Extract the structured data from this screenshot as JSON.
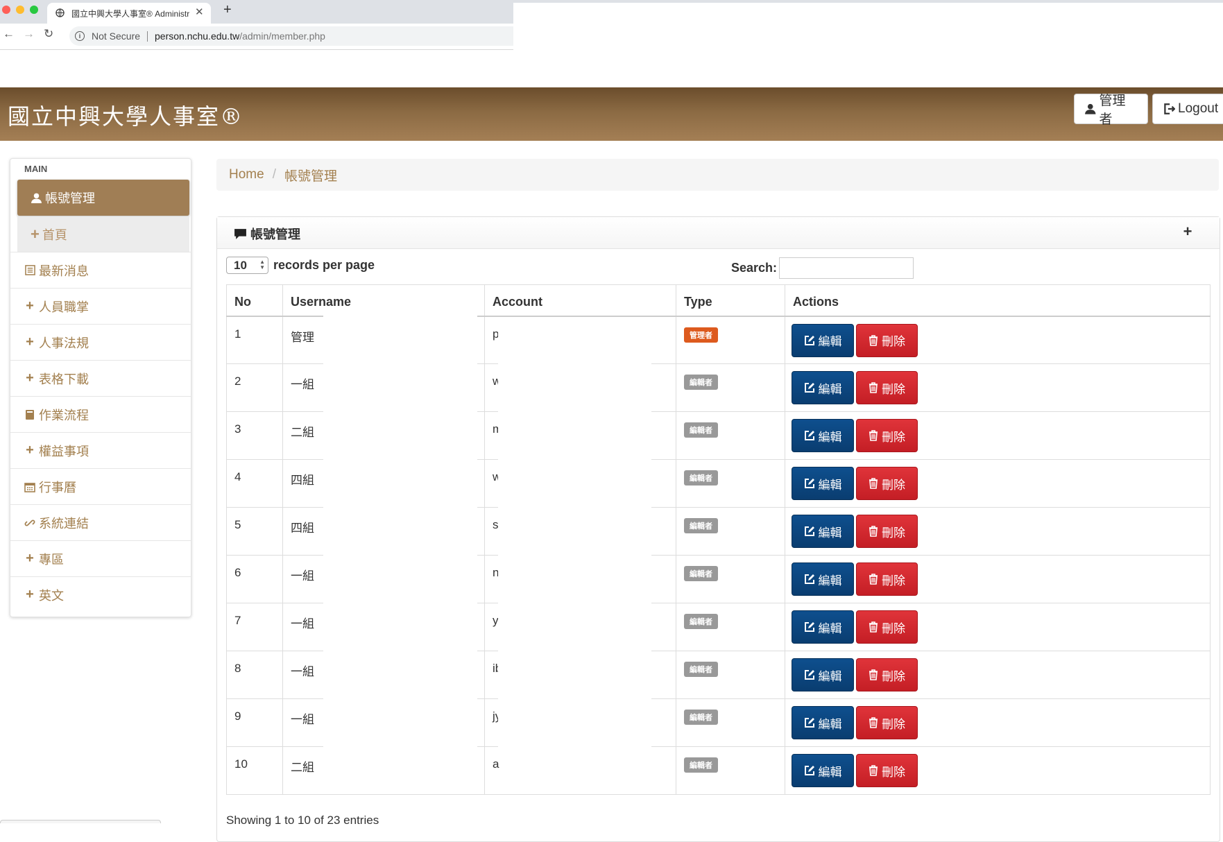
{
  "browser": {
    "tab_title": "國立中興大學人事室® Administr",
    "security_label": "Not Secure",
    "url_host": "person.nchu.edu.tw",
    "url_path": "/admin/member.php"
  },
  "header": {
    "brand": "國立中興大學人事室®",
    "admin_label": "管理者",
    "logout_label": "Logout"
  },
  "sidebar": {
    "section": "MAIN",
    "active_label": "帳號管理",
    "sub_label": "首頁",
    "items": [
      {
        "label": "最新消息",
        "icon": "list-icon"
      },
      {
        "label": "人員職掌",
        "icon": "plus-icon"
      },
      {
        "label": "人事法規",
        "icon": "plus-icon"
      },
      {
        "label": "表格下載",
        "icon": "plus-icon"
      },
      {
        "label": "作業流程",
        "icon": "book-icon"
      },
      {
        "label": "權益事項",
        "icon": "plus-icon"
      },
      {
        "label": "行事曆",
        "icon": "calendar-icon"
      },
      {
        "label": "系統連結",
        "icon": "link-icon"
      },
      {
        "label": "專區",
        "icon": "plus-icon"
      },
      {
        "label": "英文",
        "icon": "plus-icon"
      }
    ]
  },
  "breadcrumb": {
    "home": "Home",
    "current": "帳號管理"
  },
  "panel": {
    "title": "帳號管理",
    "length_value": "10",
    "length_label": "records per page",
    "search_label": "Search:",
    "search_value": "",
    "columns": [
      "No",
      "Username",
      "Account",
      "Type",
      "Actions"
    ],
    "edit_label": "編輯",
    "delete_label": "刪除",
    "rows": [
      {
        "no": "1",
        "username": "管理",
        "account": "p",
        "type": "管理者",
        "type_kind": "admin"
      },
      {
        "no": "2",
        "username": "一組",
        "account": "w",
        "type": "編輯者",
        "type_kind": "editor"
      },
      {
        "no": "3",
        "username": "二組",
        "account": "m",
        "type": "編輯者",
        "type_kind": "editor"
      },
      {
        "no": "4",
        "username": "四組",
        "account": "w",
        "type": "編輯者",
        "type_kind": "editor"
      },
      {
        "no": "5",
        "username": "四組",
        "account": "s",
        "type": "編輯者",
        "type_kind": "editor"
      },
      {
        "no": "6",
        "username": "一組",
        "account": "n",
        "type": "編輯者",
        "type_kind": "editor"
      },
      {
        "no": "7",
        "username": "一組",
        "account": "yi",
        "type": "編輯者",
        "type_kind": "editor"
      },
      {
        "no": "8",
        "username": "一組",
        "account": "ib",
        "type": "編輯者",
        "type_kind": "editor"
      },
      {
        "no": "9",
        "username": "一組",
        "account": "jy",
        "type": "編輯者",
        "type_kind": "editor"
      },
      {
        "no": "10",
        "username": "二組",
        "account": "a",
        "type": "編輯者",
        "type_kind": "editor"
      }
    ],
    "info": "Showing 1 to 10 of 23 entries"
  },
  "colors": {
    "header_brown": "#8b6a43",
    "sidebar_active": "#a07e55",
    "link_brown": "#a3804f",
    "edit_blue": "#0e4f8e",
    "delete_red": "#d9282f",
    "admin_badge": "#dd5a1e",
    "editor_badge": "#999999"
  }
}
